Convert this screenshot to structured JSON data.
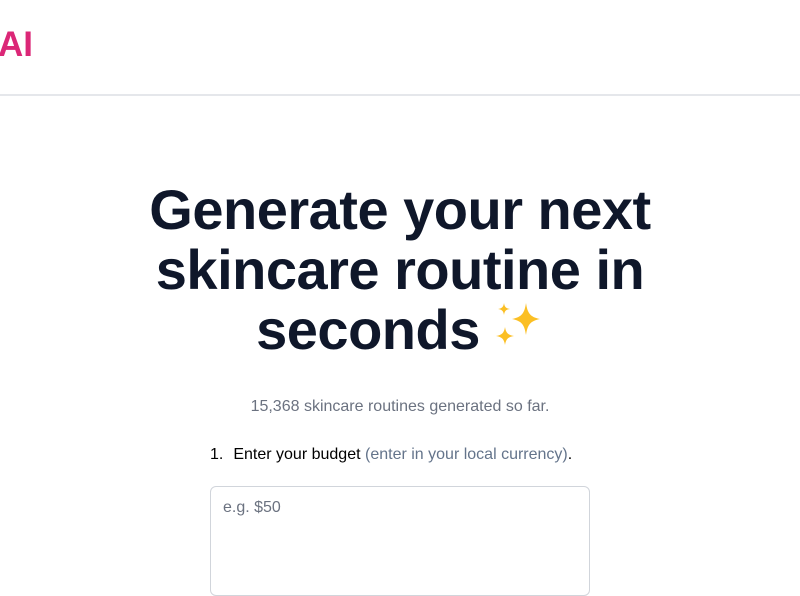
{
  "header": {
    "logo_text": "AI"
  },
  "hero": {
    "title_line1": "Generate your next",
    "title_line2": "skincare routine in",
    "title_line3": "seconds",
    "sparkle_icon": "sparkles-icon",
    "counter_text": "15,368 skincare routines generated so far."
  },
  "form": {
    "step1_number": "1.",
    "step1_label": "Enter your budget",
    "step1_hint": "(enter in your local currency)",
    "step1_period": ".",
    "budget_placeholder": "e.g. $50",
    "budget_value": ""
  },
  "colors": {
    "brand": "#db2777",
    "heading": "#0f172a",
    "muted": "#6b7280",
    "sparkle": "#fbbf24"
  }
}
